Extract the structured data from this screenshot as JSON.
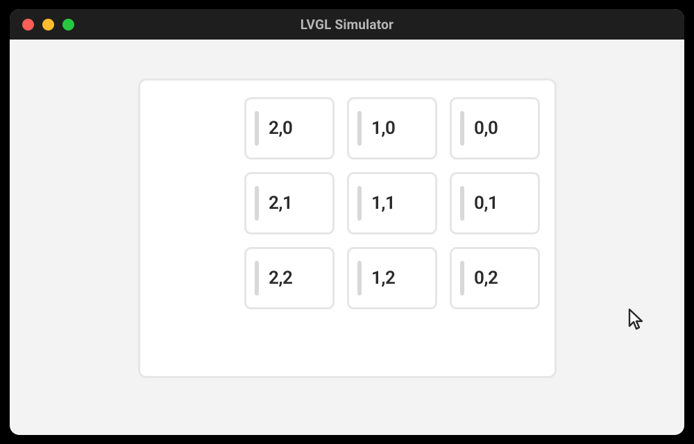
{
  "window": {
    "title": "LVGL Simulator"
  },
  "panel": {
    "grid": [
      [
        {
          "label": "2,0"
        },
        {
          "label": "1,0"
        },
        {
          "label": "0,0"
        }
      ],
      [
        {
          "label": "2,1"
        },
        {
          "label": "1,1"
        },
        {
          "label": "0,1"
        }
      ],
      [
        {
          "label": "2,2"
        },
        {
          "label": "1,2"
        },
        {
          "label": "0,2"
        }
      ]
    ]
  }
}
